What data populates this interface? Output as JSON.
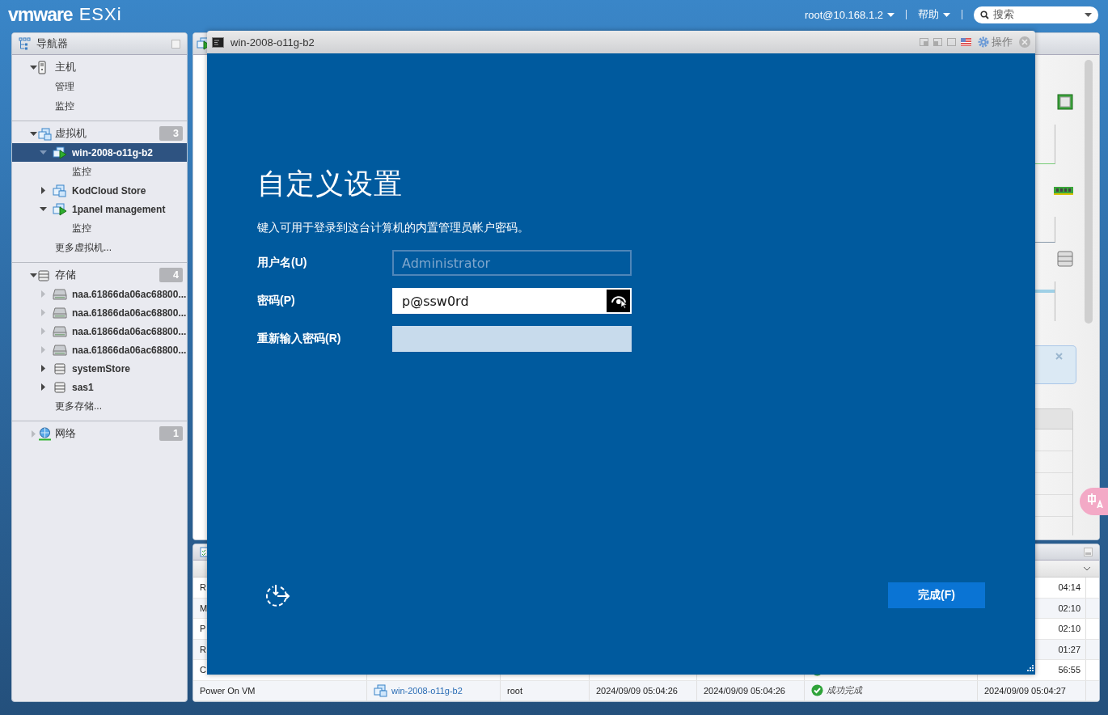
{
  "header": {
    "logo": "vmware",
    "product": "ESXi",
    "user": "root@10.168.1.2",
    "help": "帮助",
    "search": {
      "placeholder": "搜索"
    }
  },
  "navigator": {
    "title": "导航器",
    "tree": [
      {
        "kind": "host",
        "label": "主机",
        "expanded": true,
        "selected": false,
        "children": [
          {
            "kind": "link",
            "label": "管理",
            "selected": false
          },
          {
            "kind": "link",
            "label": "监控",
            "selected": false
          }
        ]
      },
      {
        "kind": "vms",
        "label": "虚拟机",
        "expanded": true,
        "selected": false,
        "badge": "3",
        "children": [
          {
            "kind": "vm",
            "label": "win-2008-o11g-b2",
            "powered": true,
            "expanded": true,
            "selected": true,
            "children": [
              {
                "kind": "link",
                "label": "监控",
                "selected": false
              }
            ]
          },
          {
            "kind": "vm",
            "label": "KodCloud Store",
            "powered": false,
            "expanded": false,
            "selected": false
          },
          {
            "kind": "vm",
            "label": "1panel management",
            "powered": true,
            "expanded": true,
            "selected": false,
            "children": [
              {
                "kind": "link",
                "label": "监控",
                "selected": false
              }
            ]
          },
          {
            "kind": "link",
            "label": "更多虚拟机...",
            "selected": false
          }
        ]
      },
      {
        "kind": "storage",
        "label": "存储",
        "expanded": true,
        "selected": false,
        "badge": "4",
        "children": [
          {
            "kind": "disk",
            "label": "naa.61866da06ac68800...",
            "expanded": false,
            "selected": false
          },
          {
            "kind": "disk",
            "label": "naa.61866da06ac68800...",
            "expanded": false,
            "selected": false
          },
          {
            "kind": "disk",
            "label": "naa.61866da06ac68800...",
            "expanded": false,
            "selected": false
          },
          {
            "kind": "disk",
            "label": "naa.61866da06ac68800...",
            "expanded": false,
            "selected": false
          },
          {
            "kind": "datastore",
            "label": "systemStore",
            "expanded": false,
            "selected": false
          },
          {
            "kind": "datastore",
            "label": "sas1",
            "expanded": false,
            "selected": false
          },
          {
            "kind": "link",
            "label": "更多存储...",
            "selected": false
          }
        ]
      },
      {
        "kind": "network",
        "label": "网络",
        "expanded": false,
        "selected": false,
        "badge": "1"
      }
    ]
  },
  "main_panel": {
    "stats": [
      {
        "kind": "cpu"
      },
      {
        "kind": "memory"
      },
      {
        "kind": "storage"
      }
    ]
  },
  "tasks": {
    "rows": [
      {
        "cells": [
          "R",
          "",
          "",
          "",
          "",
          "",
          "04:14"
        ]
      },
      {
        "cells": [
          "M",
          "",
          "",
          "",
          "",
          "",
          "02:10"
        ]
      },
      {
        "cells": [
          "P",
          "",
          "",
          "",
          "",
          "",
          "02:10"
        ]
      },
      {
        "cells": [
          "R",
          "",
          "",
          "",
          "",
          "",
          "01:27"
        ]
      },
      {
        "cells": [
          "C",
          "",
          "",
          "",
          "",
          "",
          "56:55"
        ],
        "succeeded": true
      },
      {
        "cells": [
          "Power On VM",
          "win-2008-o11g-b2",
          "root",
          "2024/09/09 05:04:26",
          "2024/09/09 05:04:26",
          "成功完成",
          "2024/09/09 05:04:27"
        ],
        "succeeded": true
      }
    ]
  },
  "console": {
    "title": "win-2008-o11g-b2",
    "actions": "操作",
    "heading": "自定义设置",
    "instruction": "键入可用于登录到这台计算机的内置管理员帐户密码。",
    "fields": [
      {
        "label": "用户名(U)",
        "placeholder": "Administrator",
        "disabled": true,
        "focused": false
      },
      {
        "label": "密码(P)",
        "value": "p@ssw0rd",
        "disabled": false,
        "focused": true
      },
      {
        "label": "重新输入密码(R)",
        "disabled": false,
        "focused": false
      }
    ],
    "finish_button": "完成(F)"
  }
}
